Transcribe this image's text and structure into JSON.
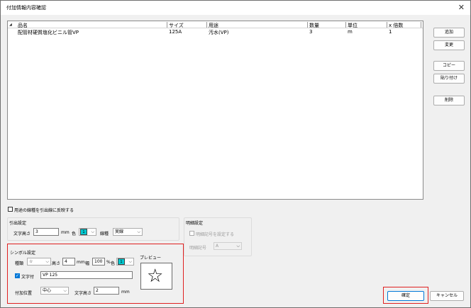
{
  "title": "付加情報内容確認",
  "close_glyph": "✕",
  "columns": [
    "品名",
    "サイズ",
    "用途",
    "数量",
    "単位",
    "x 倍数"
  ],
  "rows": [
    [
      "配管材硬質塩化ビニル管VP",
      "125A",
      "汚水(VP)",
      "3",
      "m",
      "1"
    ]
  ],
  "side_buttons": {
    "add": "追加",
    "change": "変更",
    "copy": "コピー",
    "paste": "貼り付け",
    "delete": "削除"
  },
  "reflect_check_label": "用途の線種を引出線に反映する",
  "leader": {
    "title": "引出設定",
    "text_height_label": "文字高さ",
    "text_height": "3",
    "unit_mm": "mm",
    "color_label": "色",
    "color_value": "1",
    "linetype_label": "線種",
    "linetype_value": "実線"
  },
  "detail": {
    "title": "明細設定",
    "set_check_label": "明細記号を設定する",
    "symbol_label": "明細記号",
    "symbol_value": "A"
  },
  "symbol": {
    "title": "シンボル設定",
    "type_label": "種類",
    "type_value": "☆",
    "height_label": "高さ",
    "height_value": "4",
    "mm": "mm",
    "width_label": "幅",
    "width_value": "100",
    "percent": "%",
    "color_label": "色",
    "color_value": "1",
    "preview_label": "プレビュー",
    "preview_glyph": "☆",
    "text_check_label": "文字付",
    "text_value": "VP 125",
    "position_label": "付加位置",
    "position_value": "中心",
    "text_height_label": "文字高さ",
    "text_height_value": "2",
    "mm2": "mm"
  },
  "ok_label": "確定",
  "cancel_label": "キャンセル",
  "colors": {
    "accent": "#0078d7",
    "swatch": "#00c8d0",
    "highlight": "#e02020"
  }
}
